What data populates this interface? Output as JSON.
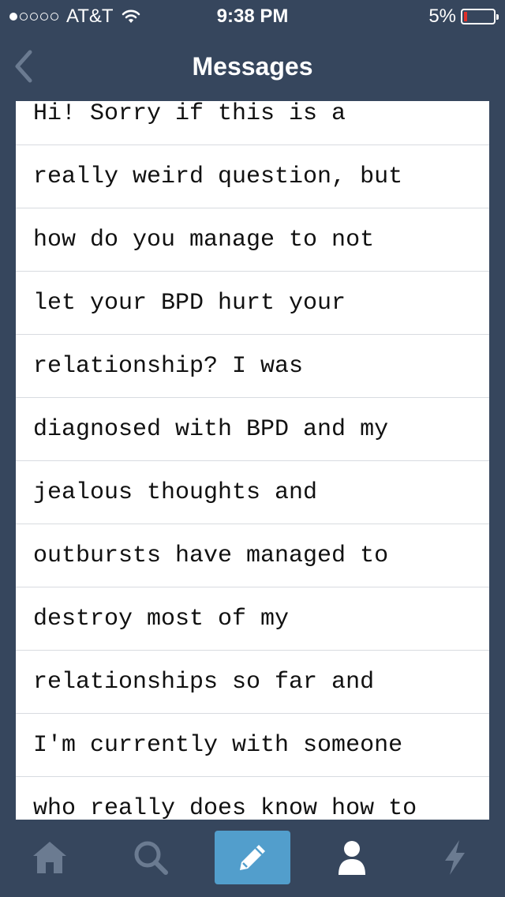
{
  "status_bar": {
    "carrier": "AT&T",
    "time": "9:38 PM",
    "battery_percent": "5%",
    "battery_level": 0.05,
    "signal_bars_filled": 1,
    "signal_bars_total": 5,
    "icons": [
      "wifi-icon",
      "battery-icon"
    ]
  },
  "nav": {
    "title": "Messages",
    "back_icon": "chevron-left-icon"
  },
  "message": {
    "lines": [
      "Hi! Sorry if this is a",
      "really weird question, but",
      "how do you manage to not",
      "let your BPD hurt your",
      "relationship? I was",
      "diagnosed with BPD and my",
      "jealous thoughts and",
      "outbursts have managed to",
      "destroy most of my",
      "relationships so far and",
      "I'm currently with someone",
      "who really does know how to"
    ]
  },
  "tab_bar": {
    "tabs": [
      {
        "icon": "home-icon",
        "active": false
      },
      {
        "icon": "search-icon",
        "active": false
      },
      {
        "icon": "pencil-icon",
        "active": true
      },
      {
        "icon": "person-icon",
        "active": false
      },
      {
        "icon": "lightning-icon",
        "active": false
      }
    ]
  },
  "colors": {
    "background": "#36465d",
    "card": "#ffffff",
    "active_tab": "#529ecc",
    "inactive_icon": "#6b7b91",
    "battery_low": "#e0302a"
  }
}
